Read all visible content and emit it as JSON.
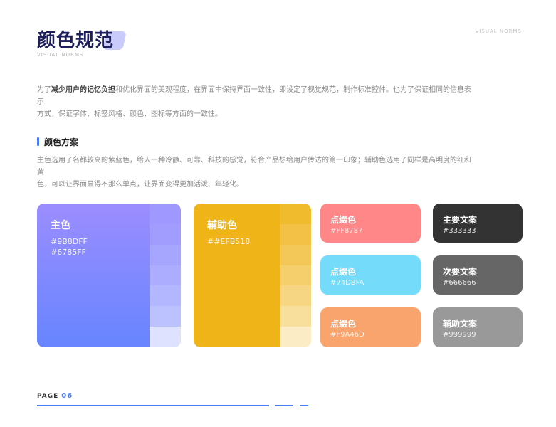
{
  "header": {
    "title": "颜色规范",
    "subtitle": "VISUAL NORMS",
    "top_right": "VISUAL NORMS"
  },
  "intro": {
    "prefix": "为了",
    "bold": "减少用户的记忆负担",
    "rest_1": "和优化界面的美观程度，在界面中保持界面一致性，即设定了视觉规范，制作标准控件。也为了保证相同的信息表示",
    "rest_2": "方式，保证字体、标签风格、颜色、图标等方面的一致性。"
  },
  "section": {
    "title": "颜色方案",
    "desc_1": "主色选用了名都较高的紫蓝色，给人一种冷静、可靠、科技的感觉，符合产品想给用户传达的第一印象；辅助色选用了同样是高明度的红和黄",
    "desc_2": "色，可以让界面显得不那么单点，让界面变得更加活泼、年轻化。"
  },
  "cards": {
    "primary": {
      "label": "主色",
      "code_1": "#9B8DFF",
      "code_2": "#6785FF",
      "color_1": "#9B8DFF",
      "color_2": "#6785FF",
      "swatches": [
        "#9e98ff",
        "#a19dff",
        "#a6a6ff",
        "#acadff",
        "#b3b7ff",
        "#bcc2ff",
        "#dfe2ff"
      ]
    },
    "secondary": {
      "label": "辅助色",
      "code": "##EFB518",
      "color": "#EFB518",
      "swatches": [
        "#f1bb2e",
        "#f2c145",
        "#f3c859",
        "#f4cf6c",
        "#f6d682",
        "#f8df9c",
        "#fbecc5"
      ]
    },
    "accents": [
      {
        "label": "点缀色",
        "code": "#FF8787",
        "color": "#FF8787"
      },
      {
        "label": "点缀色",
        "code": "#74DBFA",
        "color": "#74DBFA"
      },
      {
        "label": "点缀色",
        "code": "#F9A46D",
        "color": "#F9A46D"
      }
    ],
    "texts": [
      {
        "label": "主要文案",
        "code": "#333333",
        "color": "#333333"
      },
      {
        "label": "次要文案",
        "code": "#666666",
        "color": "#666666"
      },
      {
        "label": "辅助文案",
        "code": "#999999",
        "color": "#999999"
      }
    ]
  },
  "footer": {
    "page_label": "PAGE",
    "page_number": "06",
    "accent": "#4b7cf6"
  }
}
